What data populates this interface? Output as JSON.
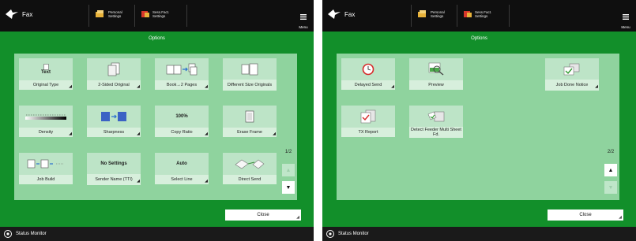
{
  "panels": [
    {
      "header": {
        "app_title": "Fax",
        "personal_settings": "Personal\nSettings",
        "shared_settings": "Sess.Fact.\nSettings",
        "menu_label": "Menu"
      },
      "options_title": "Options",
      "tiles": [
        {
          "label": "Original Type",
          "icon": "document-icon",
          "icon_text": "Text",
          "arrow": true
        },
        {
          "label": "2-Sided Original",
          "icon": "two-sided-original-icon",
          "icon_text": "",
          "arrow": true
        },
        {
          "label": "Book→2 Pages",
          "icon": "book-to-pages-icon",
          "icon_text": "",
          "arrow": true
        },
        {
          "label": "Different Size Originals",
          "icon": "different-size-originals-icon",
          "icon_text": "",
          "arrow": false
        },
        {
          "label": "Density",
          "icon": "density-slider-icon",
          "icon_text": "",
          "arrow": true
        },
        {
          "label": "Sharpness",
          "icon": "sharpness-icon",
          "icon_text": "",
          "arrow": true
        },
        {
          "label": "Copy Ratio",
          "icon": "copy-ratio-icon",
          "icon_text": "100%",
          "arrow": true
        },
        {
          "label": "Erase Frame",
          "icon": "erase-frame-icon",
          "icon_text": "",
          "arrow": true
        },
        {
          "label": "Job Build",
          "icon": "job-build-icon",
          "icon_text": "",
          "arrow": false
        },
        {
          "label": "Sender Name (TTI)",
          "icon": "sender-name-icon",
          "icon_text": "No Settings",
          "arrow": true
        },
        {
          "label": "Select Line",
          "icon": "select-line-icon",
          "icon_text": "Auto",
          "arrow": true
        },
        {
          "label": "Direct Send",
          "icon": "direct-send-icon",
          "icon_text": "",
          "arrow": false
        }
      ],
      "page": "1/2",
      "close_label": "Close",
      "status_label": "Status Monitor"
    },
    {
      "header": {
        "app_title": "Fax",
        "personal_settings": "Personal\nSettings",
        "shared_settings": "Sess.Fact.\nSettings",
        "menu_label": "Menu"
      },
      "options_title": "Options",
      "tiles": [
        {
          "label": "Delayed Send",
          "icon": "delayed-send-clock-icon",
          "icon_text": "",
          "arrow": true
        },
        {
          "label": "Preview",
          "icon": "preview-magnifier-icon",
          "icon_text": "",
          "arrow": false
        },
        {
          "label": "Job Done Notice",
          "icon": "job-done-notice-icon",
          "icon_text": "",
          "arrow": true
        },
        {
          "label": "TX Report",
          "icon": "tx-report-icon",
          "icon_text": "",
          "arrow": false
        },
        {
          "label": "Detect Feeder Multi Sheet Fd.",
          "icon": "detect-feeder-icon",
          "icon_text": "",
          "arrow": false
        }
      ],
      "page": "2/2",
      "close_label": "Close",
      "status_label": "Status Monitor"
    }
  ],
  "colors": {
    "options_green": "#128f2a",
    "tile_area": "#8fd39e",
    "tile_icon_bg": "#bde4c7",
    "tile_caption_bg": "#d7efdc",
    "top_bar": "#0f0f0f"
  }
}
